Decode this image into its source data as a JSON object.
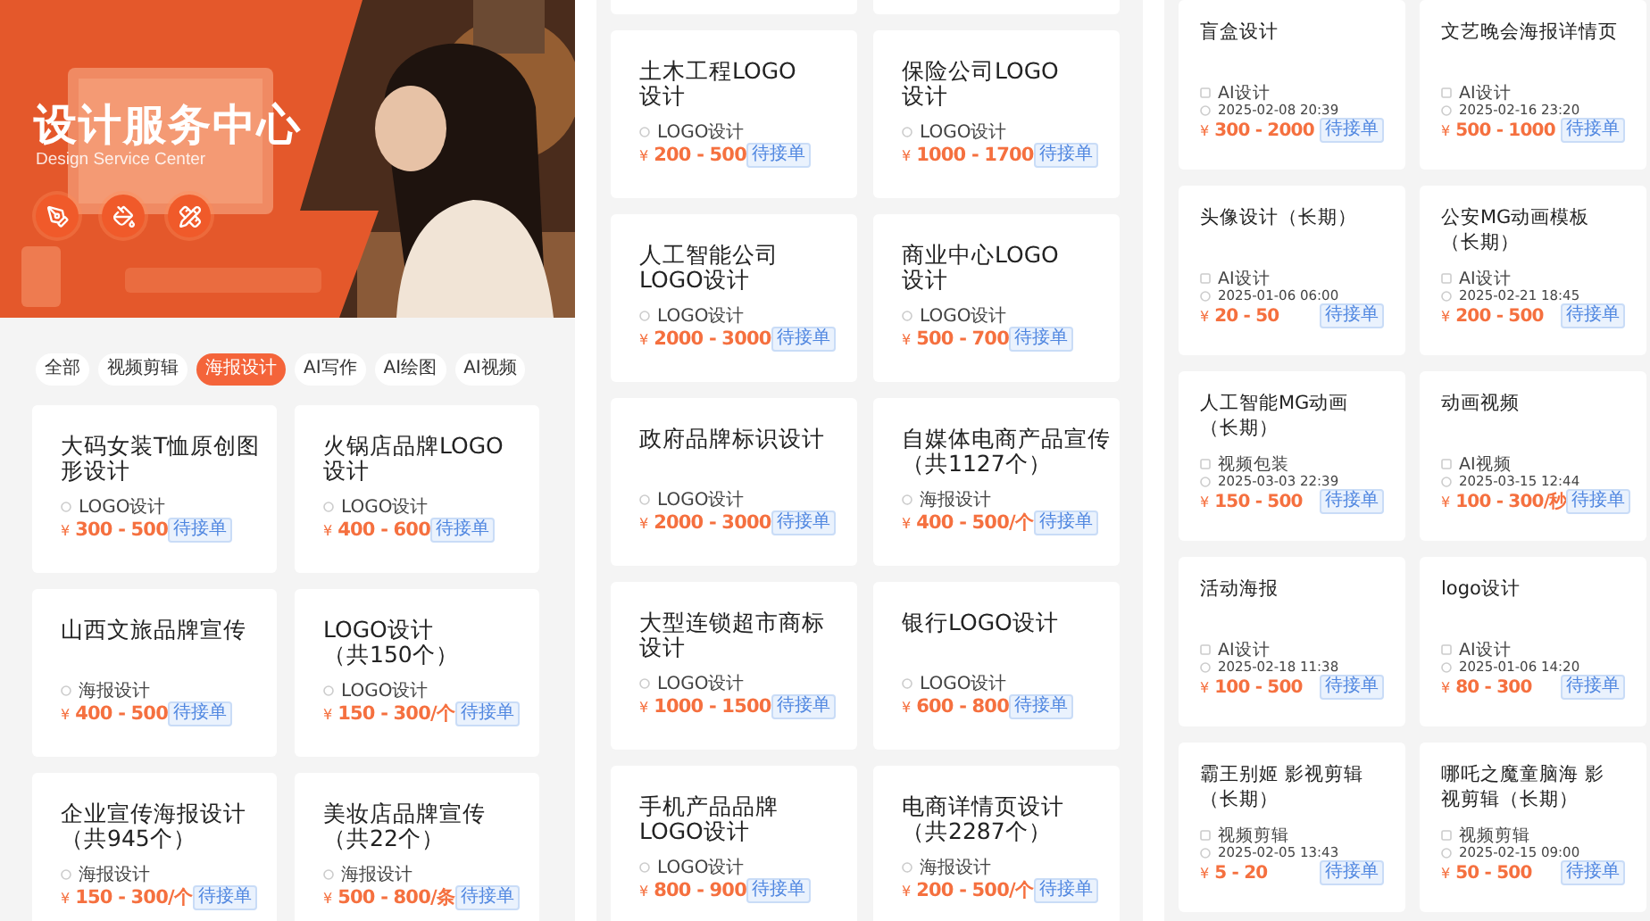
{
  "screens": [
    {
      "kind": "home",
      "hero": {
        "title": "设计服务中心",
        "subtitle": "Design Service Center"
      },
      "categories": [
        {
          "label": "全部",
          "selected": false
        },
        {
          "label": "视频剪辑",
          "selected": false
        },
        {
          "label": "海报设计",
          "selected": true
        },
        {
          "label": "AI写作",
          "selected": false
        },
        {
          "label": "AI绘图",
          "selected": false
        },
        {
          "label": "AI视频",
          "selected": false
        }
      ],
      "cards": [
        {
          "title": [
            "大码女装T恤原创图",
            "形设计"
          ],
          "category": "LOGO设计",
          "currency": "¥",
          "price": "300 - 500",
          "status": "待接单"
        },
        {
          "title": [
            "火锅店品牌LOGO",
            "设计"
          ],
          "category": "LOGO设计",
          "currency": "¥",
          "price": "400 - 600",
          "status": "待接单"
        },
        {
          "title": [
            "山西文旅品牌宣传"
          ],
          "category": "海报设计",
          "currency": "¥",
          "price": "400 - 500",
          "status": "待接单"
        },
        {
          "title": [
            "LOGO设计",
            "（共150个）"
          ],
          "category": "LOGO设计",
          "currency": "¥",
          "price": "150 - 300/个",
          "status": "待接单"
        },
        {
          "title": [
            "企业宣传海报设计",
            "（共945个）"
          ],
          "category": "海报设计",
          "currency": "¥",
          "price": "150 - 300/个",
          "status": "待接单"
        },
        {
          "title": [
            "美妆店品牌宣传",
            "（共22个）"
          ],
          "category": "海报设计",
          "currency": "¥",
          "price": "500 - 800/条",
          "status": "待接单"
        }
      ]
    },
    {
      "kind": "list",
      "cut_cards_above": true,
      "cards": [
        {
          "title": [
            "土木工程LOGO",
            "设计"
          ],
          "category": "LOGO设计",
          "currency": "¥",
          "price": "200 - 500",
          "status": "待接单"
        },
        {
          "title": [
            "保险公司LOGO",
            "设计"
          ],
          "category": "LOGO设计",
          "currency": "¥",
          "price": "1000 - 1700",
          "status": "待接单"
        },
        {
          "title": [
            "人工智能公司",
            "LOGO设计"
          ],
          "category": "LOGO设计",
          "currency": "¥",
          "price": "2000 - 3000",
          "status": "待接单"
        },
        {
          "title": [
            "商业中心LOGO",
            "设计"
          ],
          "category": "LOGO设计",
          "currency": "¥",
          "price": "500 - 700",
          "status": "待接单"
        },
        {
          "title": [
            "政府品牌标识设计"
          ],
          "category": "LOGO设计",
          "currency": "¥",
          "price": "2000 - 3000",
          "status": "待接单"
        },
        {
          "title": [
            "自媒体电商产品宣传",
            "（共1127个）"
          ],
          "category": "海报设计",
          "currency": "¥",
          "price": "400 - 500/个",
          "status": "待接单"
        },
        {
          "title": [
            "大型连锁超市商标",
            "设计"
          ],
          "category": "LOGO设计",
          "currency": "¥",
          "price": "1000 - 1500",
          "status": "待接单"
        },
        {
          "title": [
            "银行LOGO设计"
          ],
          "category": "LOGO设计",
          "currency": "¥",
          "price": "600 - 800",
          "status": "待接单"
        },
        {
          "title": [
            "手机产品品牌",
            "LOGO设计"
          ],
          "category": "LOGO设计",
          "currency": "¥",
          "price": "800 - 900",
          "status": "待接单"
        },
        {
          "title": [
            "电商详情页设计",
            "（共2287个）"
          ],
          "category": "海报设计",
          "currency": "¥",
          "price": "200 - 500/个",
          "status": "待接单"
        }
      ]
    },
    {
      "kind": "list",
      "cards": [
        {
          "title": [
            "盲盒设计"
          ],
          "category": "AI设计",
          "date": "2025-02-08 20:39",
          "currency": "¥",
          "price": "300 - 2000",
          "status": "待接单"
        },
        {
          "title": [
            "文艺晚会海报详情页"
          ],
          "category": "AI设计",
          "date": "2025-02-16 23:20",
          "currency": "¥",
          "price": "500 - 1000",
          "status": "待接单"
        },
        {
          "title": [
            "头像设计（长期）"
          ],
          "category": "AI设计",
          "date": "2025-01-06 06:00",
          "currency": "¥",
          "price": "20 - 50",
          "status": "待接单"
        },
        {
          "title": [
            "公安MG动画模板",
            "（长期）"
          ],
          "category": "AI设计",
          "date": "2025-02-21 18:45",
          "currency": "¥",
          "price": "200 - 500",
          "status": "待接单"
        },
        {
          "title": [
            "人工智能MG动画",
            "（长期）"
          ],
          "category": "视频包装",
          "date": "2025-03-03 22:39",
          "currency": "¥",
          "price": "150 - 500",
          "status": "待接单"
        },
        {
          "title": [
            "动画视频"
          ],
          "category": "AI视频",
          "date": "2025-03-15 12:44",
          "currency": "¥",
          "price": "100 - 300/秒",
          "status": "待接单"
        },
        {
          "title": [
            "活动海报"
          ],
          "category": "AI设计",
          "date": "2025-02-18 11:38",
          "currency": "¥",
          "price": "100 - 500",
          "status": "待接单"
        },
        {
          "title": [
            "logo设计"
          ],
          "category": "AI设计",
          "date": "2025-01-06 14:20",
          "currency": "¥",
          "price": "80 - 300",
          "status": "待接单"
        },
        {
          "title": [
            "霸王别姬 影视剪辑",
            "（长期）"
          ],
          "category": "视频剪辑",
          "date": "2025-02-05 13:43",
          "currency": "¥",
          "price": "5 - 20",
          "status": "待接单"
        },
        {
          "title": [
            "哪吒之魔童脑海 影",
            "视剪辑（长期）"
          ],
          "category": "视频剪辑",
          "date": "2025-02-15 09:00",
          "currency": "¥",
          "price": "50 - 500",
          "status": "待接单"
        }
      ]
    }
  ]
}
